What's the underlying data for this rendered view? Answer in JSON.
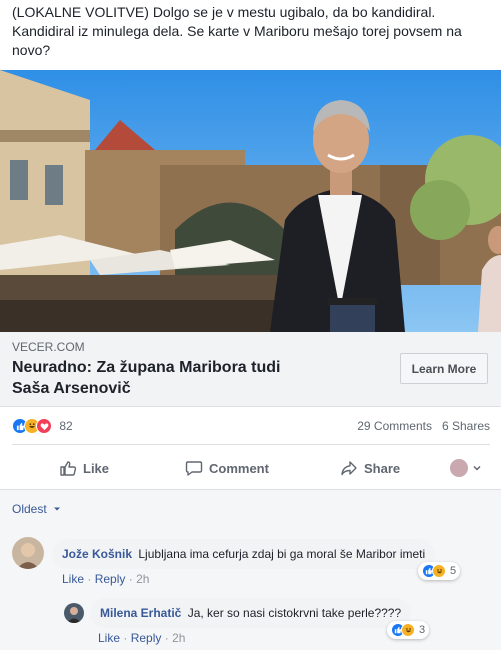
{
  "post": {
    "text": "(LOKALNE VOLITVE) Dolgo se je v mestu ugibalo, da bo kandidiral. Kandidiral iz minulega dela. Se karte v Mariboru mešajo torej povsem na novo?"
  },
  "link": {
    "domain": "VECER.COM",
    "title": "Neuradno: Za župana Maribora tudi Saša Arsenovič",
    "cta": "Learn More"
  },
  "stats": {
    "reactions": "82",
    "comments": "29 Comments",
    "shares": "6 Shares"
  },
  "actions": {
    "like": "Like",
    "comment": "Comment",
    "share": "Share"
  },
  "sort": {
    "label": "Oldest"
  },
  "comments": [
    {
      "author": "Jože Košnik",
      "text": "Ljubljana ima cefurja zdaj bi ga moral še Maribor imeti",
      "like": "Like",
      "reply": "Reply",
      "sep": "·",
      "time": "2h",
      "reactions": "5"
    },
    {
      "author": "Milena Erhatič",
      "text": "Ja, ker so nasi cistokrvni take perle????",
      "like": "Like",
      "reply": "Reply",
      "sep": "·",
      "time": "2h",
      "reactions": "3"
    }
  ],
  "colors": {
    "link_blue": "#385898",
    "like_blue": "#1877f2",
    "love_red": "#f33e58",
    "haha_yellow": "#f7b125"
  }
}
